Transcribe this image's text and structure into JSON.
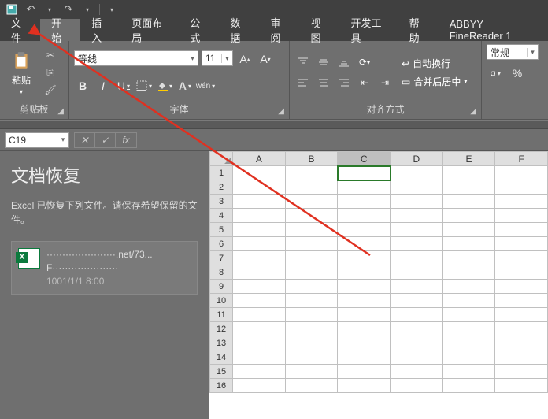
{
  "qat": {
    "save": "💾",
    "undo": "↶",
    "redo": "↷"
  },
  "tabs": {
    "file": "文件",
    "home": "开始",
    "insert": "插入",
    "layout": "页面布局",
    "formula": "公式",
    "data": "数据",
    "review": "审阅",
    "view": "视图",
    "dev": "开发工具",
    "help": "帮助",
    "abbyy": "ABBYY FineReader 1"
  },
  "ribbon": {
    "clipboard": {
      "label": "剪贴板",
      "paste": "粘贴"
    },
    "font": {
      "label": "字体",
      "name": "等线",
      "size": "11",
      "bold": "B",
      "italic": "I",
      "underline": "U",
      "ruby": "wén"
    },
    "align": {
      "label": "对齐方式",
      "wrap": "自动换行",
      "merge": "合并后居中"
    },
    "number": {
      "label": "",
      "format": "常规",
      "percent": "%"
    }
  },
  "fx": {
    "cell": "C19",
    "cancel": "✕",
    "ok": "✓",
    "fx": "fx"
  },
  "recovery": {
    "title": "文档恢复",
    "desc": "Excel 已恢复下列文件。请保存希望保留的文件。",
    "item": {
      "line1": "······················.net/73...",
      "line2": "F·····················",
      "line3": "1001/1/1 8:00"
    }
  },
  "grid": {
    "cols": [
      "A",
      "B",
      "C",
      "D",
      "E",
      "F"
    ],
    "rows": [
      1,
      2,
      3,
      4,
      5,
      6,
      7,
      8,
      9,
      10,
      11,
      12,
      13,
      14,
      15,
      16
    ],
    "selected_col": 2,
    "selected_row": 0
  }
}
